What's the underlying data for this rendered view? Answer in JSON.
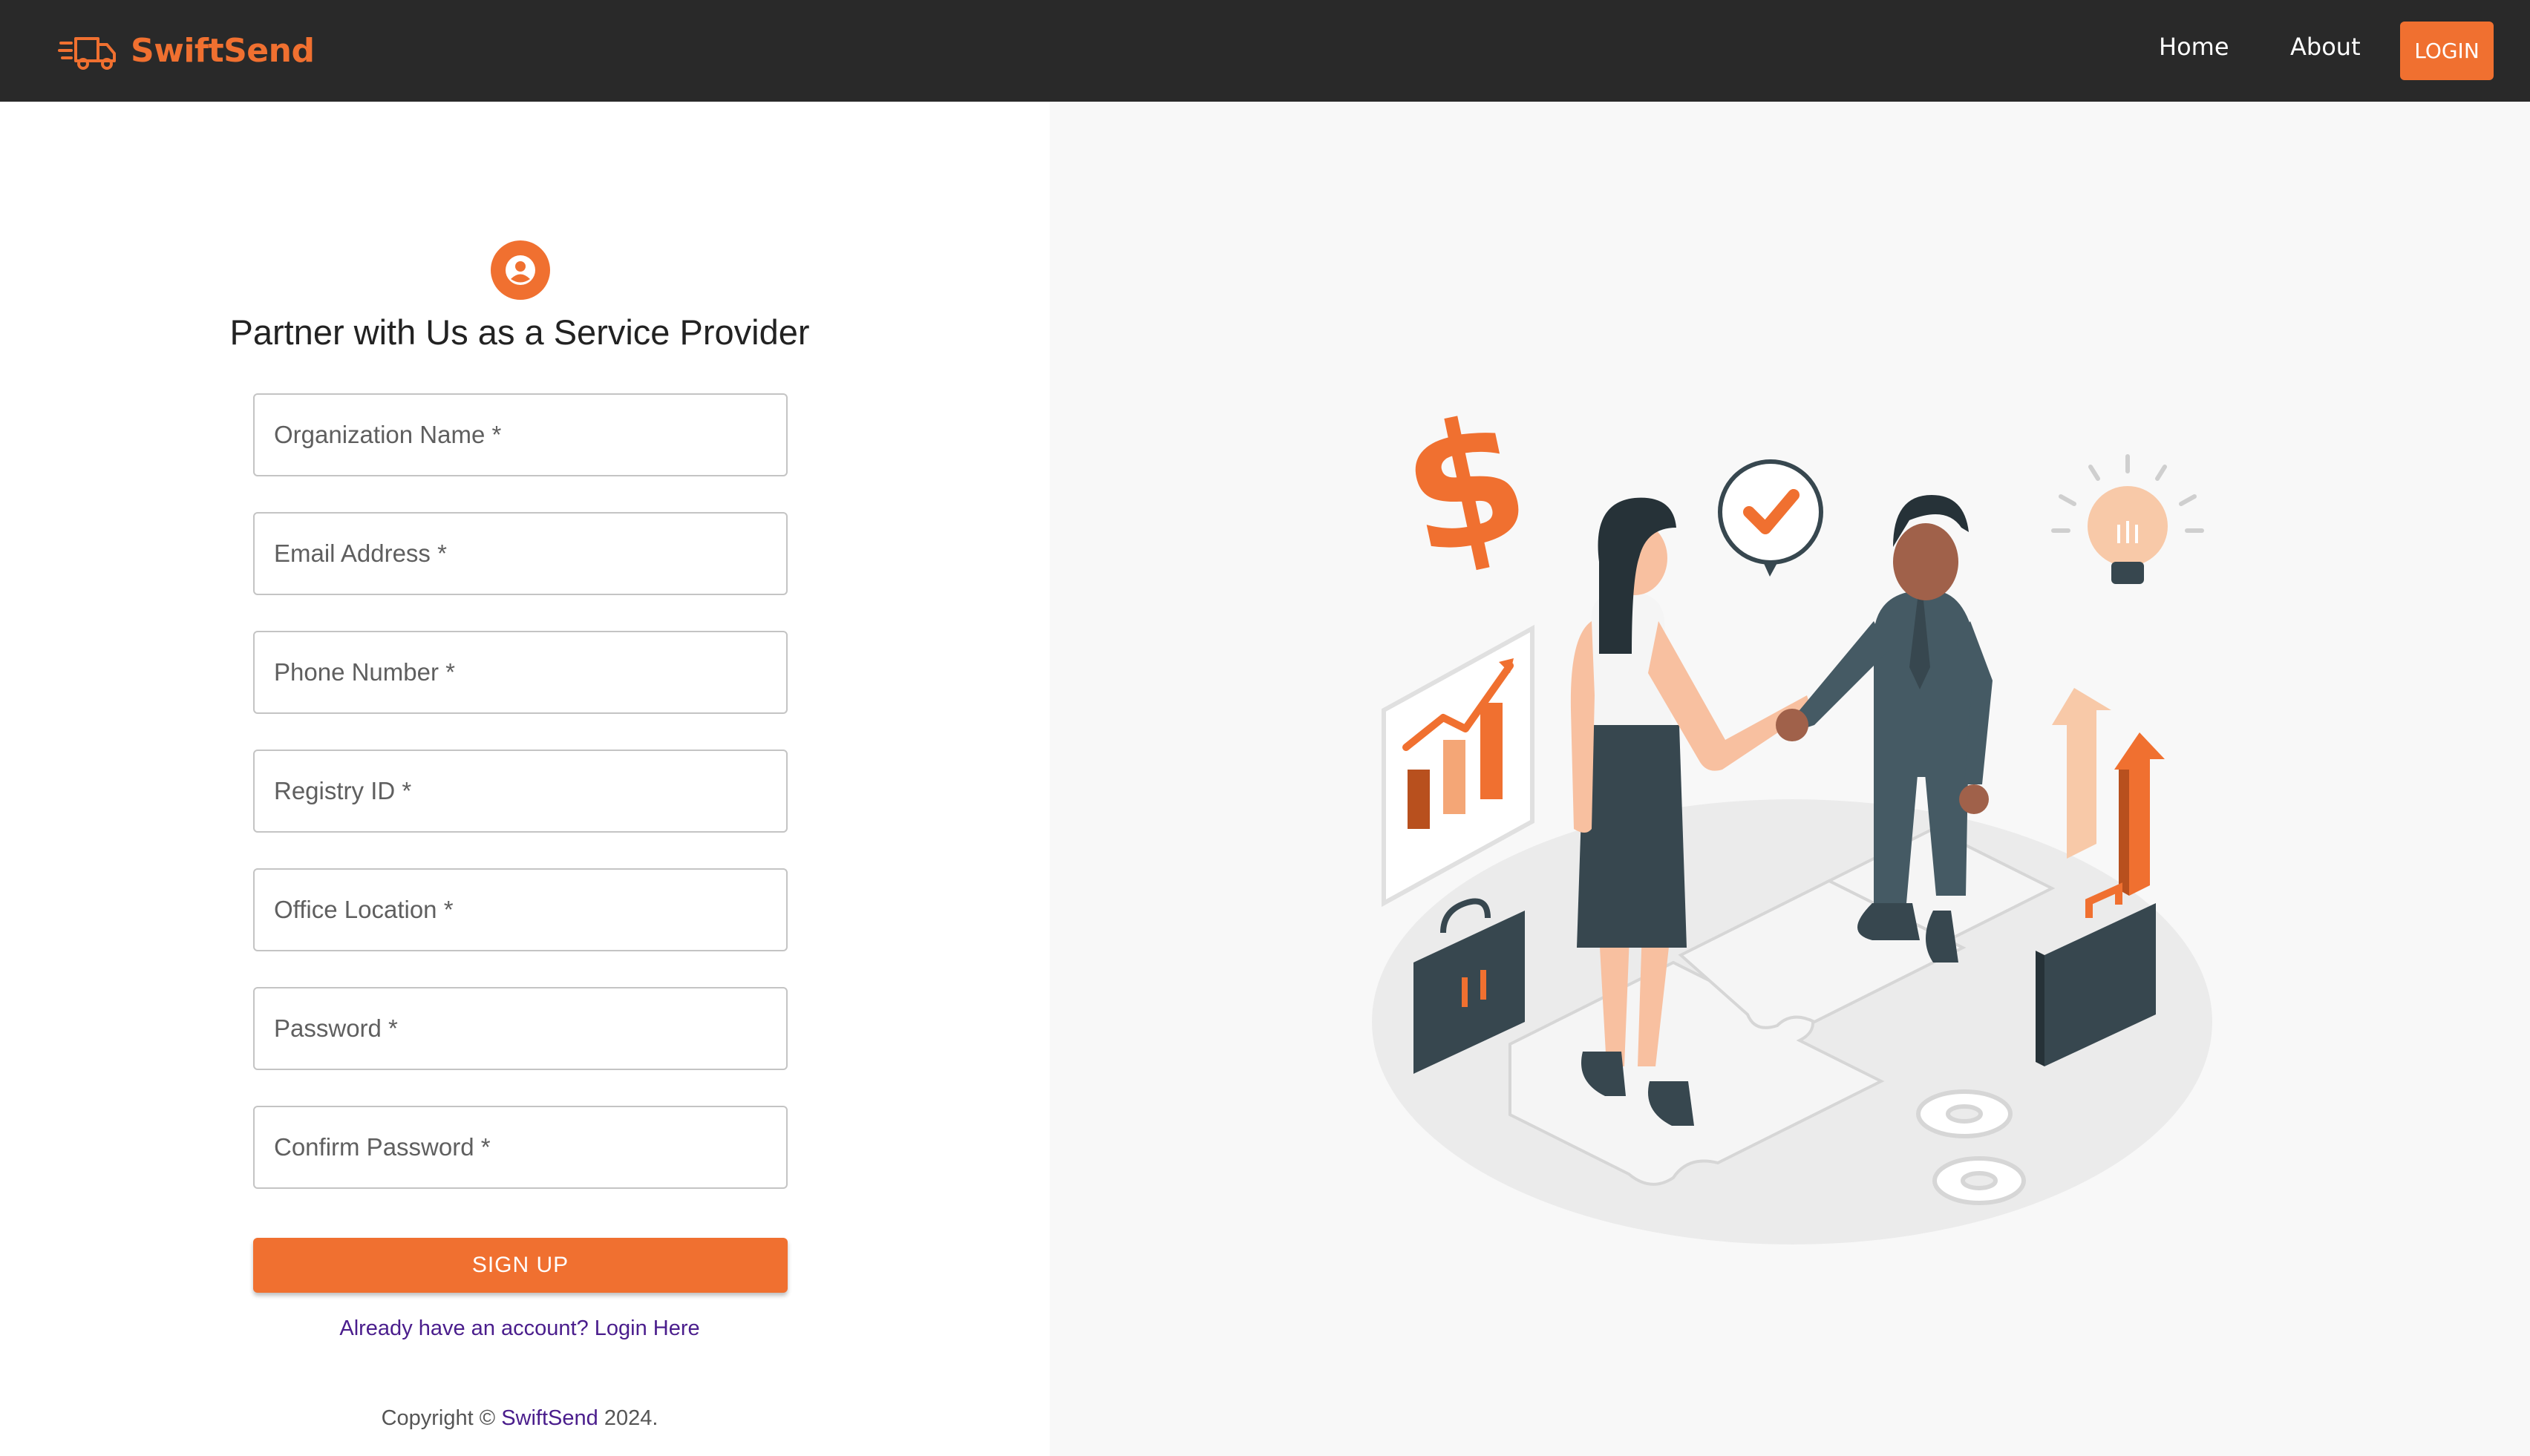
{
  "navbar": {
    "brand_name": "SwiftSend",
    "brand_icon": "delivery-truck-icon",
    "links": [
      {
        "label": "Home"
      },
      {
        "label": "About"
      }
    ],
    "login_label": "LOGIN",
    "background": "#292929",
    "accent": "#f07030"
  },
  "form": {
    "icon": "account-circle-icon",
    "title": "Partner with Us as a Service Provider",
    "fields": [
      {
        "placeholder": "Organization Name *"
      },
      {
        "placeholder": "Email Address *"
      },
      {
        "placeholder": "Phone Number *"
      },
      {
        "placeholder": "Registry ID *"
      },
      {
        "placeholder": "Office Location *"
      },
      {
        "placeholder": "Password *"
      },
      {
        "placeholder": "Confirm Password *"
      }
    ],
    "submit_label": "SIGN UP",
    "login_prompt": "Already have an account? Login Here"
  },
  "footer": {
    "prefix": "Copyright ©",
    "brand": "SwiftSend",
    "suffix": "2024."
  },
  "illustration": {
    "name": "business-handshake-illustration",
    "colors": {
      "orange": "#f07030",
      "dark": "#37474f",
      "panel": "#f8f8f8"
    }
  }
}
